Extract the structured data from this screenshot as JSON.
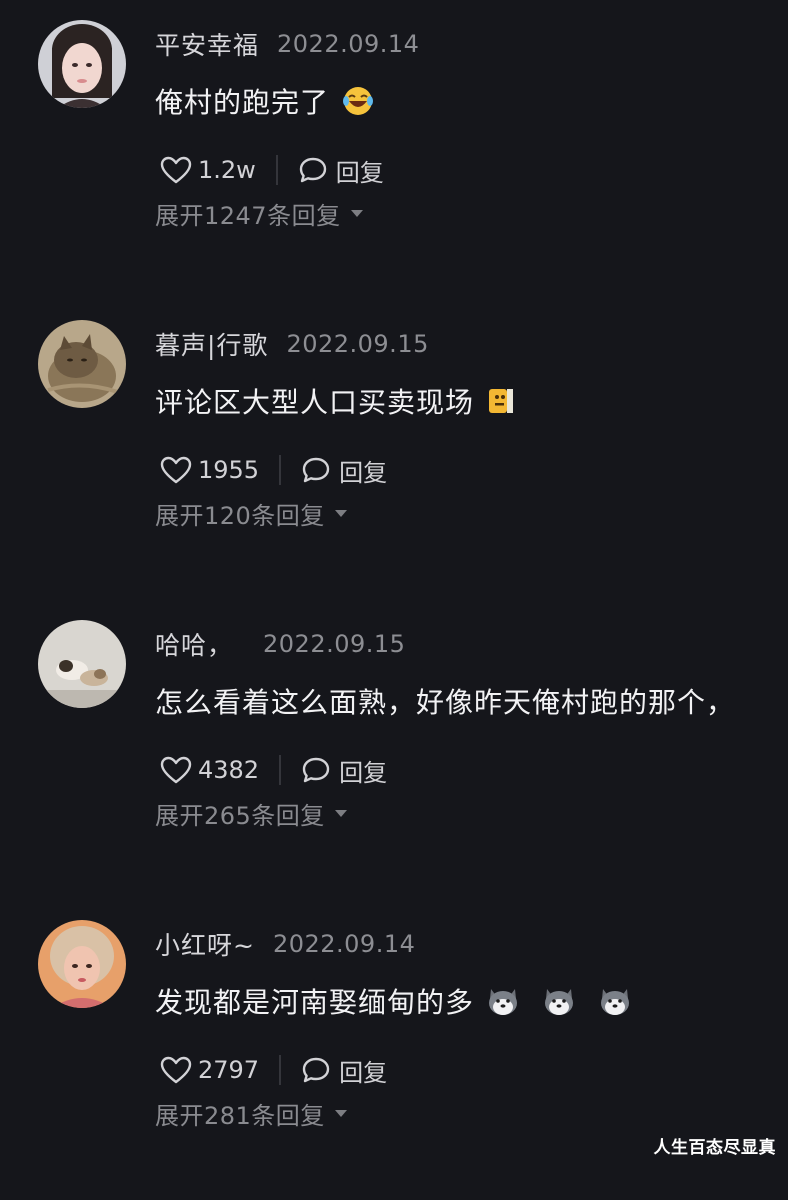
{
  "comments": [
    {
      "username": "平安幸福",
      "date": "2022.09.14",
      "text": "俺村的跑完了",
      "emoji": [
        "laughing-face-icon"
      ],
      "likes": "1.2w",
      "reply_label": "回复",
      "expand_label": "展开1247条回复"
    },
    {
      "username": "暮声|行歌",
      "date": "2022.09.15",
      "text": "评论区大型人口买卖现场",
      "emoji": [
        "peeking-face-icon"
      ],
      "likes": "1955",
      "reply_label": "回复",
      "expand_label": "展开120条回复"
    },
    {
      "username": "哈哈，",
      "date": "2022.09.15",
      "text": "怎么看着这么面熟，好像昨天俺村跑的那个，",
      "emoji": [],
      "likes": "4382",
      "reply_label": "回复",
      "expand_label": "展开265条回复"
    },
    {
      "username": "小红呀~",
      "date": "2022.09.14",
      "text": "发现都是河南娶缅甸的多",
      "emoji": [
        "husky-face-icon",
        "husky-face-icon",
        "husky-face-icon"
      ],
      "likes": "2797",
      "reply_label": "回复",
      "expand_label": "展开281条回复"
    }
  ],
  "watermark": "人生百态尽显真",
  "colors": {
    "background": "#15161b",
    "text_primary": "#f2f2f4",
    "text_secondary": "#8a8b90"
  }
}
